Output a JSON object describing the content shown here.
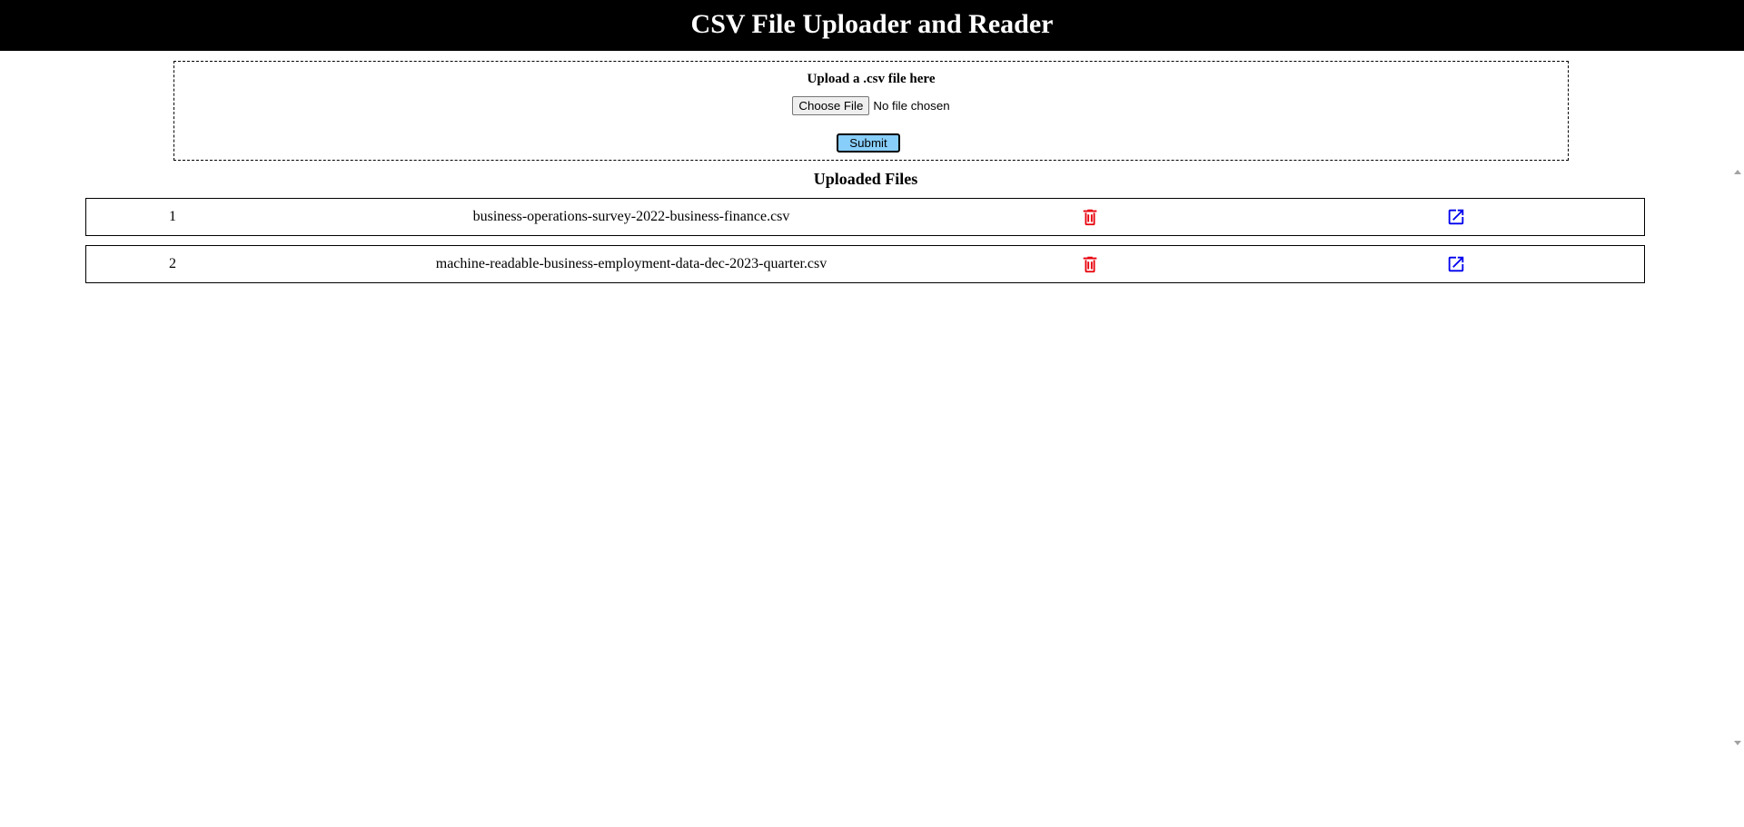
{
  "header": {
    "title": "CSV File Uploader and Reader"
  },
  "upload": {
    "label": "Upload a .csv file here",
    "choose_button": "Choose File",
    "no_file_text": "No file chosen",
    "submit_button": "Submit"
  },
  "files": {
    "heading": "Uploaded Files",
    "items": [
      {
        "index": "1",
        "name": "business-operations-survey-2022-business-finance.csv"
      },
      {
        "index": "2",
        "name": "machine-readable-business-employment-data-dec-2023-quarter.csv"
      }
    ],
    "delete_icon": "trash-icon",
    "open_icon": "external-link-icon"
  },
  "colors": {
    "header_bg": "#000000",
    "submit_bg": "#87cefa",
    "delete_icon": "#e8000b",
    "open_icon": "#0000ee"
  }
}
